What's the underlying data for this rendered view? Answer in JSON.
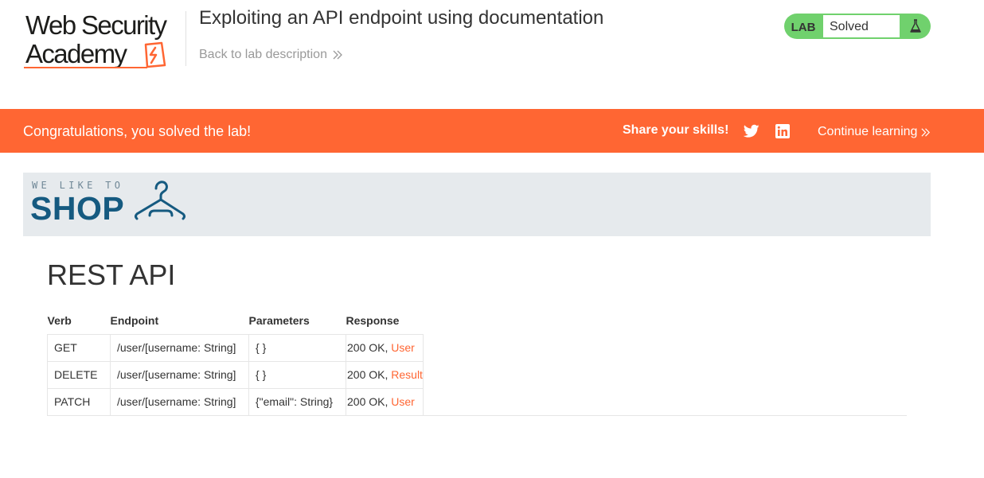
{
  "logo": {
    "line1": "Web Security",
    "line2": "Academy"
  },
  "lab": {
    "title": "Exploiting an API endpoint using documentation",
    "back_link": "Back to lab description",
    "status_label": "LAB",
    "status_value": "Solved",
    "status_color": "#70d16d"
  },
  "banner": {
    "message": "Congratulations, you solved the lab!",
    "share_label": "Share your skills!",
    "continue_link": "Continue learning",
    "color": "#ff6633"
  },
  "shop": {
    "tagline": "WE LIKE TO",
    "name": "SHOP"
  },
  "main": {
    "title": "REST API",
    "table": {
      "headers": [
        "Verb",
        "Endpoint",
        "Parameters",
        "Response"
      ],
      "rows": [
        {
          "verb": "GET",
          "endpoint": "/user/[username: String]",
          "params": "{ }",
          "status": "200 OK,",
          "type": "User"
        },
        {
          "verb": "DELETE",
          "endpoint": "/user/[username: String]",
          "params": "{ }",
          "status": "200 OK,",
          "type": "Result"
        },
        {
          "verb": "PATCH",
          "endpoint": "/user/[username: String]",
          "params": "{\"email\": String}",
          "status": "200 OK,",
          "type": "User"
        }
      ]
    }
  }
}
